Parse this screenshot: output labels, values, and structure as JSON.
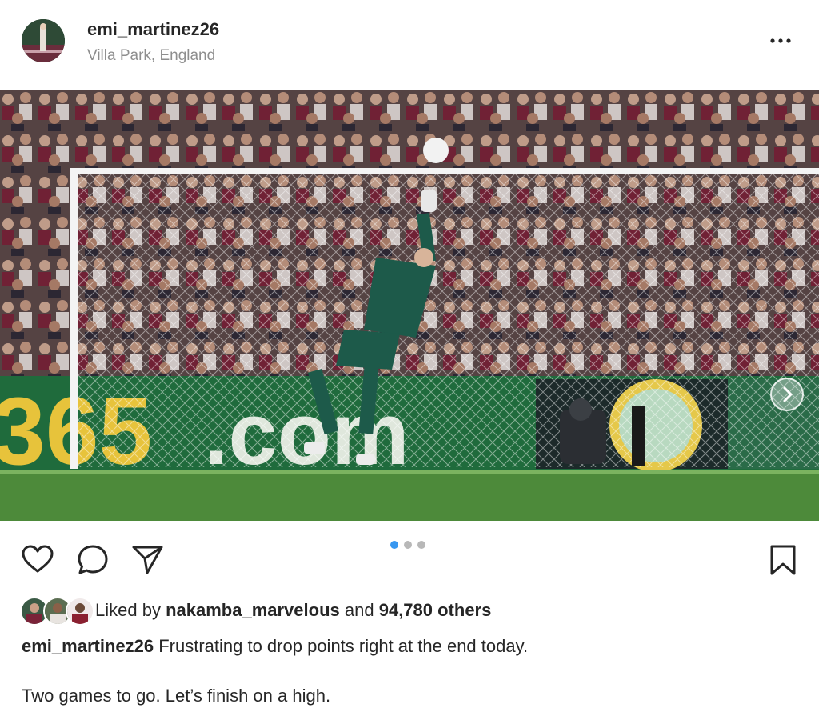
{
  "post": {
    "username": "emi_martinez26",
    "location": "Villa Park, England",
    "more_icon": "ellipsis-icon",
    "photo_description_icon": "photo",
    "carousel": {
      "total": 3,
      "active_index": 0,
      "active_color": "#3897f0",
      "inactive_color": "#b8b8b8"
    },
    "actions": {
      "like_icon": "heart-icon",
      "comment_icon": "comment-icon",
      "share_icon": "send-icon",
      "save_icon": "bookmark-icon"
    },
    "likes": {
      "prefix": "Liked by",
      "user": "nakamba_marvelous",
      "connector": "and",
      "count": "94,780 others"
    },
    "caption": {
      "author": "emi_martinez26",
      "text": "Frustrating to drop points right at the end today.",
      "line2": "Two games to go. Let’s finish on a high."
    },
    "colors": {
      "text": "#262626",
      "muted": "#8e8e8e",
      "pitch": "#4d8a3a",
      "board": "#1f6b3c"
    }
  }
}
